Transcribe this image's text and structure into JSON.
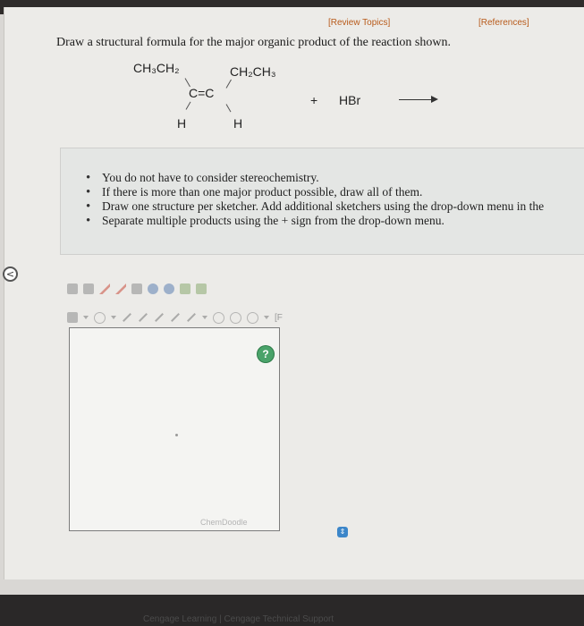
{
  "header": {
    "review_topics": "[Review Topics]",
    "references": "[References]"
  },
  "question": "Draw a structural formula for the major organic product of the reaction shown.",
  "reaction": {
    "substituent_top_left": "CH₃CH₂",
    "substituent_top_right": "CH₂CH₃",
    "double_bond": "C=C",
    "substituent_bottom_left": "H",
    "substituent_bottom_right": "H",
    "plus": "+",
    "reagent": "HBr"
  },
  "hints": [
    "You do not have to consider stereochemistry.",
    "If there is more than one major product possible, draw all of them.",
    "Draw one structure per sketcher. Add additional sketchers using the drop-down menu in the",
    "Separate multiple products using the + sign from the drop-down menu."
  ],
  "sketcher": {
    "help_label": "?",
    "brand": "ChemDoodle",
    "toolbar_text": "[F"
  },
  "footer": {
    "text": "Cengage Learning | Cengage Technical Support"
  }
}
